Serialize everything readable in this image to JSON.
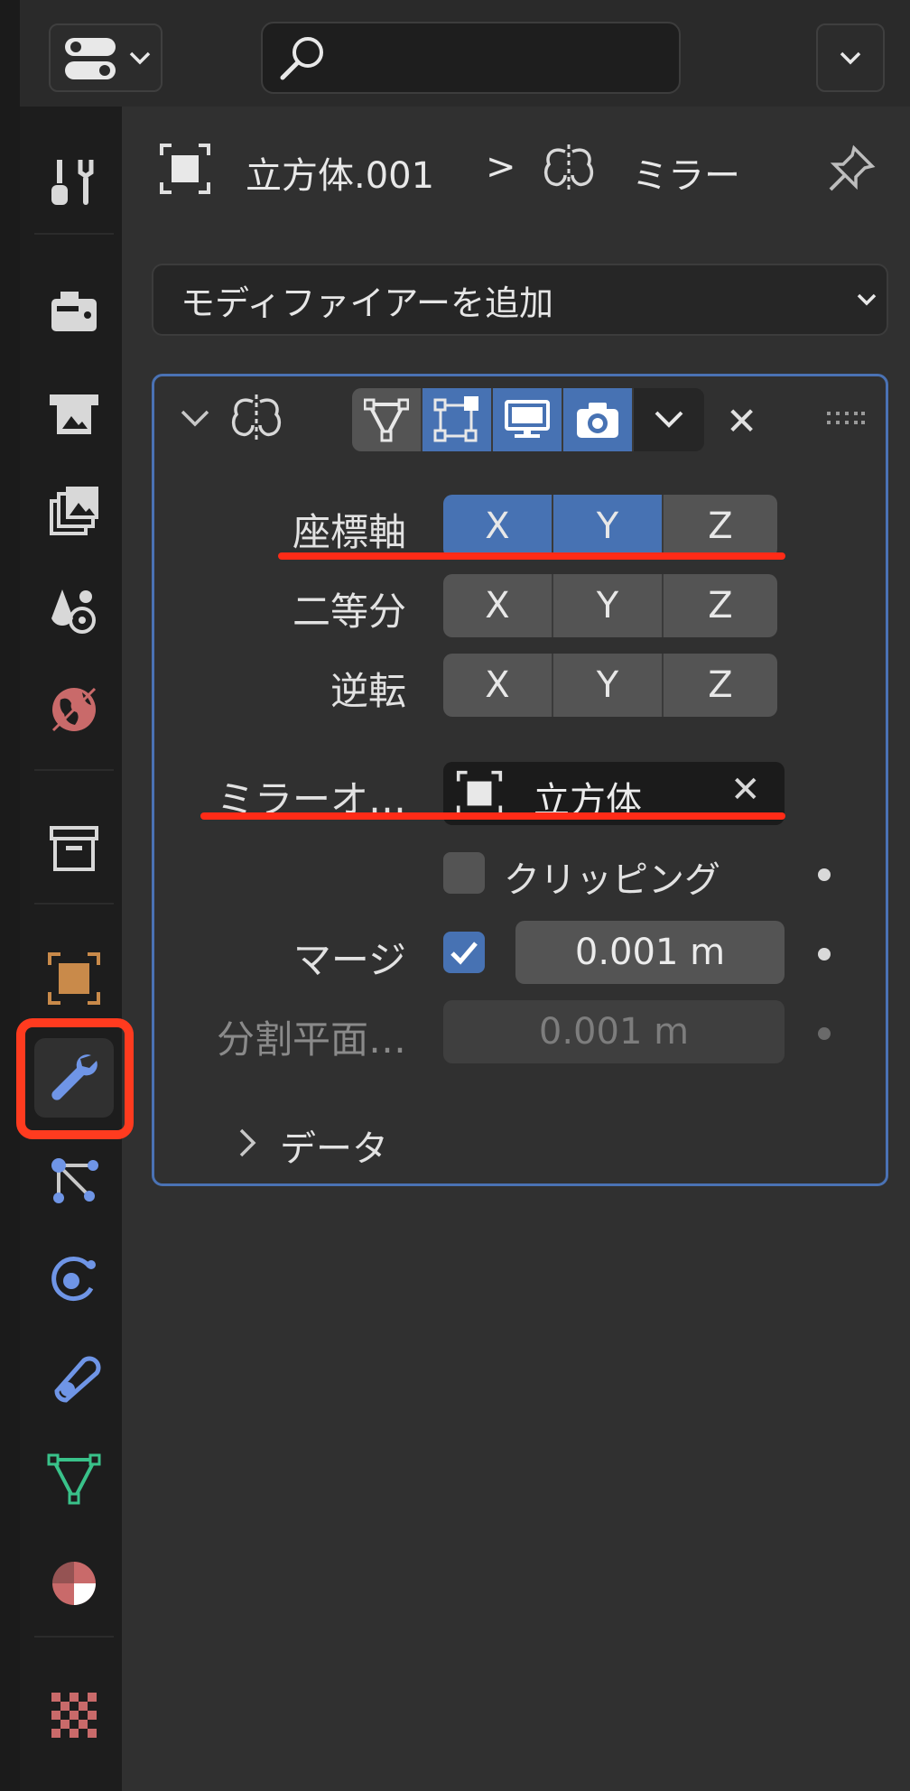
{
  "search": {
    "placeholder": ""
  },
  "breadcrumb": {
    "object_name": "立方体.001",
    "separator": ">",
    "modifier_name": "ミラー"
  },
  "add_modifier_label": "モディファイアーを追加",
  "axes": {
    "axis_label": "座標軸",
    "bisect_label": "二等分",
    "flip_label": "逆転",
    "buttons": [
      "X",
      "Y",
      "Z"
    ],
    "axis_active": [
      "X",
      "Y"
    ]
  },
  "mirror_object": {
    "label": "ミラーオ…",
    "value": "立方体",
    "clear_glyph": "✕"
  },
  "clipping": {
    "label": "クリッピング",
    "checked": false
  },
  "merge": {
    "label": "マージ",
    "checked": true,
    "value": "0.001 m"
  },
  "bisect_distance": {
    "label": "分割平面…",
    "value": "0.001 m"
  },
  "data_section": {
    "label": "データ"
  },
  "close_glyph": "✕",
  "colors": {
    "accent": "#4772b3",
    "panel_border": "#4a72b4",
    "highlight_red": "#ff3b1f",
    "wrench": "#6f95e6"
  }
}
